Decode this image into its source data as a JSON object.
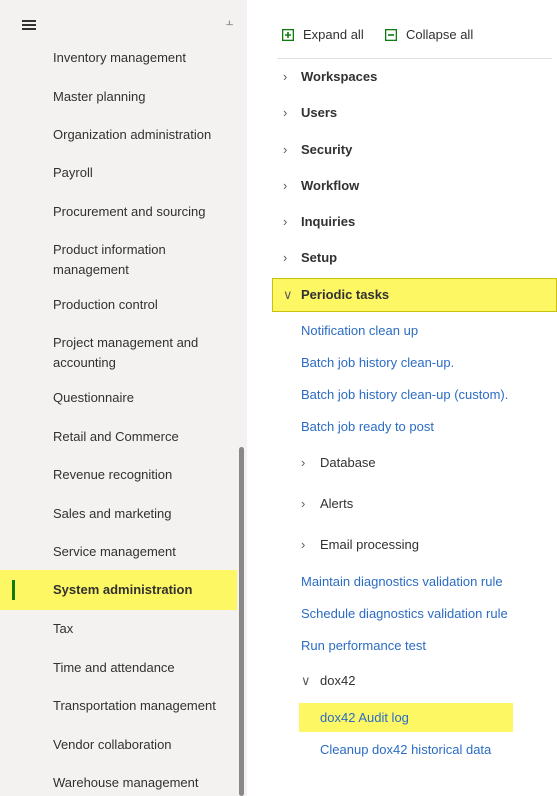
{
  "nav": {
    "items": [
      {
        "label": "Inventory management"
      },
      {
        "label": "Master planning"
      },
      {
        "label": "Organization administration"
      },
      {
        "label": "Payroll"
      },
      {
        "label": "Procurement and sourcing"
      },
      {
        "label": "Product information management"
      },
      {
        "label": "Production control"
      },
      {
        "label": "Project management and accounting"
      },
      {
        "label": "Questionnaire"
      },
      {
        "label": "Retail and Commerce"
      },
      {
        "label": "Revenue recognition"
      },
      {
        "label": "Sales and marketing"
      },
      {
        "label": "Service management"
      },
      {
        "label": "System administration",
        "selected": true
      },
      {
        "label": "Tax"
      },
      {
        "label": "Time and attendance"
      },
      {
        "label": "Transportation management"
      },
      {
        "label": "Vendor collaboration"
      },
      {
        "label": "Warehouse management"
      }
    ]
  },
  "toolbar": {
    "expand_all": "Expand all",
    "collapse_all": "Collapse all"
  },
  "groups": {
    "workspaces": "Workspaces",
    "users": "Users",
    "security": "Security",
    "workflow": "Workflow",
    "inquiries": "Inquiries",
    "setup": "Setup",
    "periodic_tasks": "Periodic tasks"
  },
  "periodic": {
    "notification_clean_up": "Notification clean up",
    "batch_history_cleanup": "Batch job history clean-up.",
    "batch_history_cleanup_custom": "Batch job history clean-up (custom).",
    "batch_ready_to_post": "Batch job ready to post",
    "database": "Database",
    "alerts": "Alerts",
    "email_processing": "Email processing",
    "maintain_diag": "Maintain diagnostics validation rule",
    "schedule_diag": "Schedule diagnostics validation rule",
    "run_perf": "Run performance test",
    "dox42": "dox42",
    "dox42_audit_log": "dox42 Audit log",
    "cleanup_dox42": "Cleanup dox42 historical data"
  },
  "colors": {
    "highlight": "#fdf764",
    "link": "#2b6cc4",
    "selected_bar": "#107c10",
    "icon_green": "#107c10"
  },
  "icons": {
    "menu": "hamburger-icon",
    "pin": "pin-icon",
    "expand": "expand-all-icon",
    "collapse": "collapse-all-icon"
  }
}
